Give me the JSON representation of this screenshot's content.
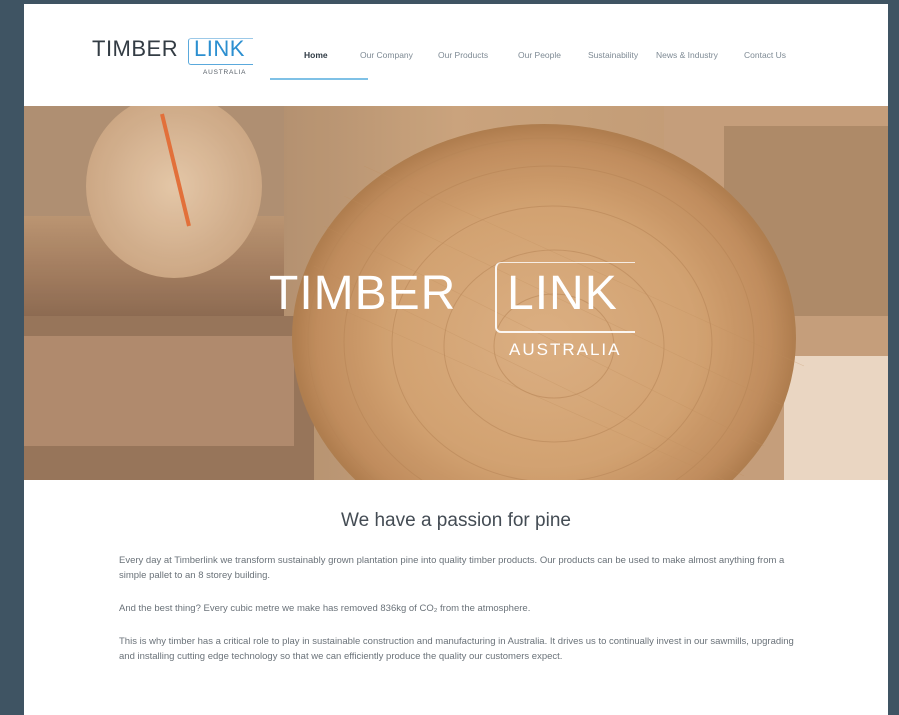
{
  "logo": {
    "timber": "TIMBER",
    "link": "LINK",
    "country": "AUSTRALIA"
  },
  "nav": {
    "items": [
      {
        "label": "Home",
        "active": true
      },
      {
        "label": "Our Company"
      },
      {
        "label": "Our Products"
      },
      {
        "label": "Our People"
      },
      {
        "label": "Sustainability"
      },
      {
        "label": "News & Industry"
      },
      {
        "label": "Contact Us"
      }
    ]
  },
  "hero": {
    "timber": "TIMBER",
    "link": "LINK",
    "country": "AUSTRALIA"
  },
  "content": {
    "heading": "We have a passion for pine",
    "paragraphs": [
      "Every day at Timberlink we transform sustainably grown plantation pine into quality timber products. Our products can be used to make almost anything from a simple pallet to an 8 storey building.",
      "And the best thing? Every cubic metre we make has removed 836kg of CO₂ from the atmosphere.",
      "This is why timber has a critical role to play in sustainable construction and manufacturing in Australia. It drives us to continually invest in our sawmills, upgrading and installing cutting edge technology so that we can efficiently produce the quality our customers expect."
    ]
  },
  "colors": {
    "background": "#3f5463",
    "brand_blue": "#2c8fd0",
    "nav_underline": "#7fc1e6",
    "dark_text": "#333c44"
  }
}
